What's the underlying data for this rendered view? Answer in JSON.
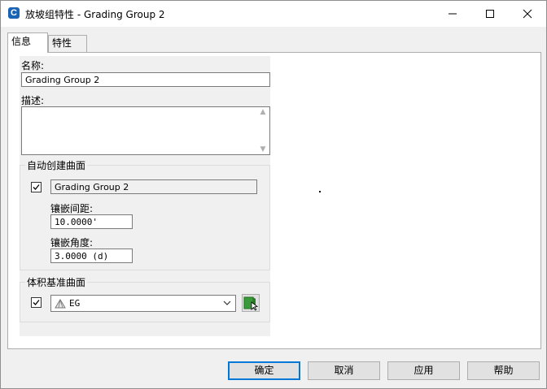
{
  "window": {
    "title": "放坡组特性 - Grading Group 2"
  },
  "titlebar": {
    "app_icon": "civil3d-c-icon",
    "minimize_icon": "minimize-icon",
    "maximize_icon": "maximize-icon",
    "close_icon": "close-icon"
  },
  "tabs": [
    {
      "label": "信息",
      "active": true
    },
    {
      "label": "特性",
      "active": false
    }
  ],
  "info": {
    "name_label": "名称:",
    "name_value": "Grading Group 2",
    "description_label": "描述:",
    "description_value": ""
  },
  "auto_surface": {
    "group_title": "自动创建曲面",
    "checked": true,
    "surface_name": "Grading Group 2",
    "tessellation_spacing_label": "镶嵌间距:",
    "tessellation_spacing_value": "10.0000'",
    "tessellation_angle_label": "镶嵌角度:",
    "tessellation_angle_value": "3.0000 (d)"
  },
  "volume_base": {
    "group_title": "体积基准曲面",
    "checked": true,
    "surface_value": "EG",
    "surface_icon": "tin-surface-icon",
    "pick_icon": "pick-surface-icon"
  },
  "buttons": {
    "ok": "确定",
    "cancel": "取消",
    "apply": "应用",
    "help": "帮助"
  },
  "colors": {
    "accent": "#0078d7",
    "app_icon": "#1a64b6",
    "pick_icon": "#3a9a3a"
  }
}
